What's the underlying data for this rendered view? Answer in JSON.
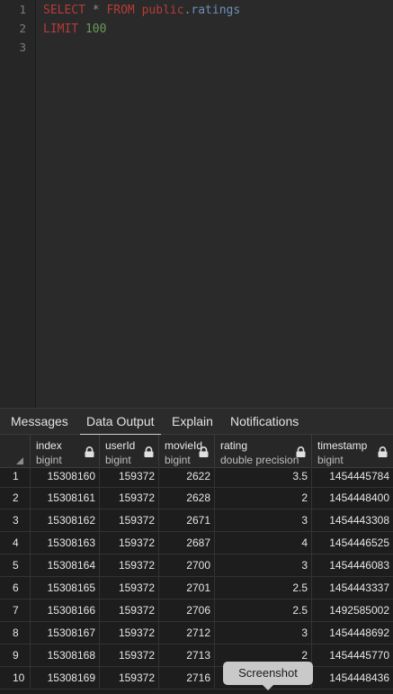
{
  "editor": {
    "line_numbers": [
      "1",
      "2",
      "3"
    ],
    "line1": {
      "select": "SELECT",
      "star": "*",
      "from": "FROM",
      "schema": "public",
      "dot": ".",
      "table": "ratings"
    },
    "line2": {
      "limit": "LIMIT",
      "value": "100"
    }
  },
  "tabs": [
    "Messages",
    "Data Output",
    "Explain",
    "Notifications"
  ],
  "active_tab": "Data Output",
  "columns": [
    {
      "name": "index",
      "type": "bigint"
    },
    {
      "name": "userId",
      "type": "bigint"
    },
    {
      "name": "movieId",
      "type": "bigint"
    },
    {
      "name": "rating",
      "type": "double precision"
    },
    {
      "name": "timestamp",
      "type": "bigint"
    }
  ],
  "rows": [
    [
      "1",
      "15308160",
      "159372",
      "2622",
      "3.5",
      "1454445784"
    ],
    [
      "2",
      "15308161",
      "159372",
      "2628",
      "2",
      "1454448400"
    ],
    [
      "3",
      "15308162",
      "159372",
      "2671",
      "3",
      "1454443308"
    ],
    [
      "4",
      "15308163",
      "159372",
      "2687",
      "4",
      "1454446525"
    ],
    [
      "5",
      "15308164",
      "159372",
      "2700",
      "3",
      "1454446083"
    ],
    [
      "6",
      "15308165",
      "159372",
      "2701",
      "2.5",
      "1454443337"
    ],
    [
      "7",
      "15308166",
      "159372",
      "2706",
      "2.5",
      "1492585002"
    ],
    [
      "8",
      "15308167",
      "159372",
      "2712",
      "3",
      "1454448692"
    ],
    [
      "9",
      "15308168",
      "159372",
      "2713",
      "2",
      "1454445770"
    ],
    [
      "10",
      "15308169",
      "159372",
      "2716",
      "",
      "1454448436"
    ]
  ],
  "tooltip": "Screenshot",
  "colors": {
    "background": "#212121",
    "keyword": "#b63c38",
    "identifier": "#6b8fb5",
    "number": "#6a9b55"
  }
}
